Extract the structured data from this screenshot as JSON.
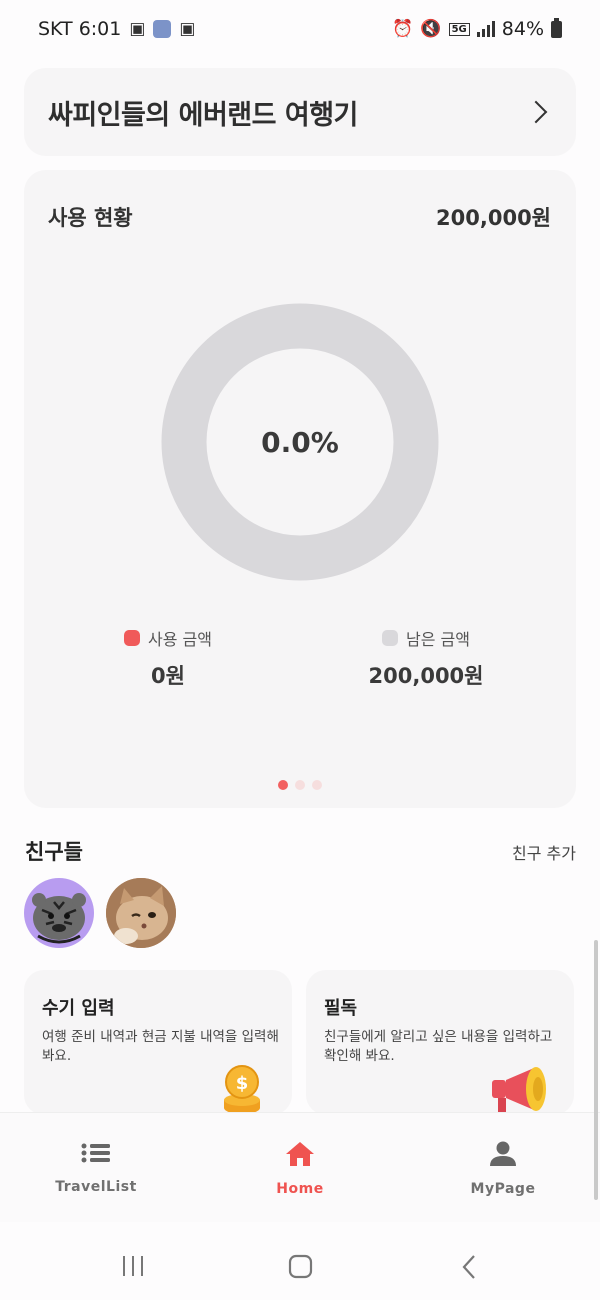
{
  "status_bar": {
    "carrier_time": "SKT 6:01",
    "network": "5G",
    "battery": "84%"
  },
  "trip": {
    "title": "싸피인들의 에버랜드 여행기"
  },
  "usage": {
    "label": "사용 현황",
    "total": "200,000원",
    "percent_text": "0.0%",
    "used_fraction": 0.0,
    "used_label": "사용 금액",
    "used_value": "0원",
    "remaining_label": "남은 금액",
    "remaining_value": "200,000원",
    "colors": {
      "used": "#f05a5a",
      "remaining": "#d9d8db"
    },
    "pager": {
      "count": 3,
      "active": 0
    }
  },
  "friends": {
    "title": "친구들",
    "add_label": "친구 추가",
    "avatars": [
      "tiger-avatar",
      "cat-avatar"
    ]
  },
  "features": [
    {
      "title": "수기 입력",
      "desc": "여행 준비 내역과 현금 지불 내역을 입력해 봐요.",
      "icon": "coin-stack-icon"
    },
    {
      "title": "필독",
      "desc": "친구들에게 알리고 싶은 내용을 입력하고 확인해 봐요.",
      "icon": "megaphone-icon"
    }
  ],
  "bottom_nav": {
    "items": [
      {
        "label": "TravelList",
        "icon": "list-icon",
        "active": false
      },
      {
        "label": "Home",
        "icon": "home-icon",
        "active": true
      },
      {
        "label": "MyPage",
        "icon": "person-icon",
        "active": false
      }
    ],
    "active_color": "#ef5350",
    "inactive_color": "#707070"
  }
}
